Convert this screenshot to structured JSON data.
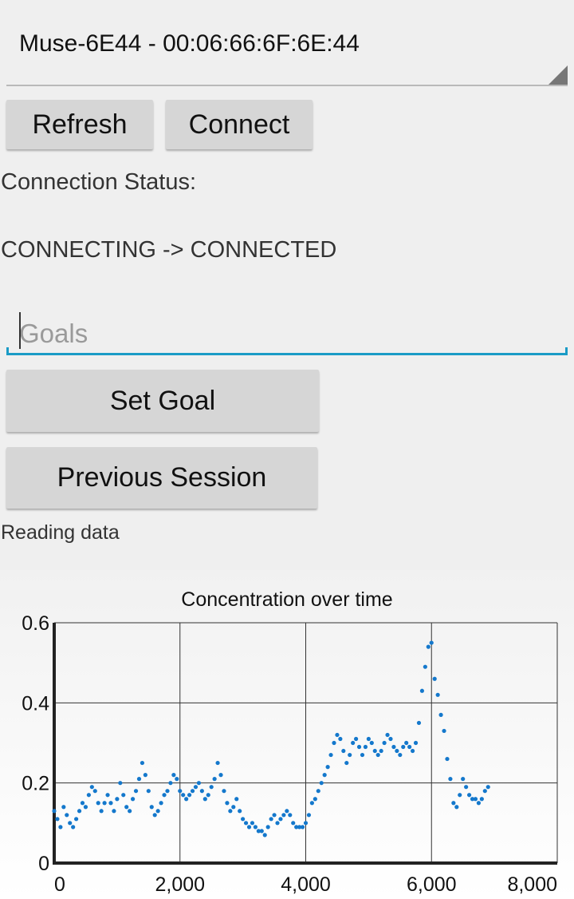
{
  "device_selector": {
    "selected": "Muse-6E44 - 00:06:66:6F:6E:44"
  },
  "buttons": {
    "refresh": "Refresh",
    "connect": "Connect",
    "set_goal": "Set Goal",
    "previous_session": "Previous Session"
  },
  "connection": {
    "label": "Connection Status:",
    "value": "CONNECTING -> CONNECTED"
  },
  "goals_input": {
    "placeholder": "Goals",
    "value": ""
  },
  "reading_status": "Reading data",
  "colors": {
    "accent": "#1a9bc6",
    "series": "#1478cc",
    "button": "#d6d6d6"
  },
  "chart_data": {
    "type": "scatter",
    "title": "Concentration over time",
    "xlabel": "",
    "ylabel": "",
    "xlim": [
      0,
      8000
    ],
    "ylim": [
      0,
      0.6
    ],
    "x_ticks": [
      0,
      2000,
      4000,
      6000,
      8000
    ],
    "x_tick_labels": [
      "0",
      "2,000",
      "4,000",
      "6,000",
      "8,000"
    ],
    "y_ticks": [
      0,
      0.2,
      0.4,
      0.6
    ],
    "y_tick_labels": [
      "0",
      "0.2",
      "0.4",
      "0.6"
    ],
    "grid": true,
    "series": [
      {
        "color": "#1478cc",
        "points": [
          [
            0,
            0.13
          ],
          [
            50,
            0.11
          ],
          [
            100,
            0.09
          ],
          [
            150,
            0.14
          ],
          [
            200,
            0.12
          ],
          [
            250,
            0.1
          ],
          [
            300,
            0.09
          ],
          [
            350,
            0.11
          ],
          [
            400,
            0.13
          ],
          [
            450,
            0.15
          ],
          [
            500,
            0.14
          ],
          [
            550,
            0.17
          ],
          [
            600,
            0.19
          ],
          [
            650,
            0.18
          ],
          [
            700,
            0.15
          ],
          [
            750,
            0.13
          ],
          [
            800,
            0.15
          ],
          [
            850,
            0.17
          ],
          [
            900,
            0.15
          ],
          [
            950,
            0.13
          ],
          [
            1000,
            0.16
          ],
          [
            1050,
            0.2
          ],
          [
            1100,
            0.17
          ],
          [
            1150,
            0.14
          ],
          [
            1200,
            0.13
          ],
          [
            1250,
            0.16
          ],
          [
            1300,
            0.18
          ],
          [
            1350,
            0.21
          ],
          [
            1400,
            0.25
          ],
          [
            1450,
            0.22
          ],
          [
            1500,
            0.18
          ],
          [
            1550,
            0.14
          ],
          [
            1600,
            0.12
          ],
          [
            1650,
            0.13
          ],
          [
            1700,
            0.15
          ],
          [
            1750,
            0.17
          ],
          [
            1800,
            0.18
          ],
          [
            1850,
            0.2
          ],
          [
            1900,
            0.22
          ],
          [
            1950,
            0.21
          ],
          [
            2000,
            0.18
          ],
          [
            2050,
            0.17
          ],
          [
            2100,
            0.16
          ],
          [
            2150,
            0.17
          ],
          [
            2200,
            0.18
          ],
          [
            2250,
            0.19
          ],
          [
            2300,
            0.2
          ],
          [
            2350,
            0.18
          ],
          [
            2400,
            0.16
          ],
          [
            2450,
            0.17
          ],
          [
            2500,
            0.19
          ],
          [
            2550,
            0.21
          ],
          [
            2600,
            0.25
          ],
          [
            2650,
            0.22
          ],
          [
            2700,
            0.18
          ],
          [
            2750,
            0.15
          ],
          [
            2800,
            0.13
          ],
          [
            2850,
            0.14
          ],
          [
            2900,
            0.16
          ],
          [
            2950,
            0.13
          ],
          [
            3000,
            0.11
          ],
          [
            3050,
            0.1
          ],
          [
            3100,
            0.09
          ],
          [
            3150,
            0.1
          ],
          [
            3200,
            0.09
          ],
          [
            3250,
            0.08
          ],
          [
            3300,
            0.08
          ],
          [
            3350,
            0.07
          ],
          [
            3400,
            0.09
          ],
          [
            3450,
            0.11
          ],
          [
            3500,
            0.12
          ],
          [
            3550,
            0.1
          ],
          [
            3600,
            0.11
          ],
          [
            3650,
            0.12
          ],
          [
            3700,
            0.13
          ],
          [
            3750,
            0.12
          ],
          [
            3800,
            0.1
          ],
          [
            3850,
            0.09
          ],
          [
            3900,
            0.09
          ],
          [
            3950,
            0.09
          ],
          [
            4000,
            0.1
          ],
          [
            4050,
            0.12
          ],
          [
            4100,
            0.15
          ],
          [
            4150,
            0.16
          ],
          [
            4200,
            0.18
          ],
          [
            4250,
            0.2
          ],
          [
            4300,
            0.22
          ],
          [
            4350,
            0.24
          ],
          [
            4400,
            0.27
          ],
          [
            4450,
            0.3
          ],
          [
            4500,
            0.32
          ],
          [
            4550,
            0.31
          ],
          [
            4600,
            0.28
          ],
          [
            4650,
            0.25
          ],
          [
            4700,
            0.27
          ],
          [
            4750,
            0.3
          ],
          [
            4800,
            0.31
          ],
          [
            4850,
            0.29
          ],
          [
            4900,
            0.27
          ],
          [
            4950,
            0.29
          ],
          [
            5000,
            0.31
          ],
          [
            5050,
            0.3
          ],
          [
            5100,
            0.28
          ],
          [
            5150,
            0.27
          ],
          [
            5200,
            0.28
          ],
          [
            5250,
            0.3
          ],
          [
            5300,
            0.32
          ],
          [
            5350,
            0.31
          ],
          [
            5400,
            0.29
          ],
          [
            5450,
            0.28
          ],
          [
            5500,
            0.27
          ],
          [
            5550,
            0.29
          ],
          [
            5600,
            0.3
          ],
          [
            5650,
            0.29
          ],
          [
            5700,
            0.28
          ],
          [
            5750,
            0.3
          ],
          [
            5800,
            0.35
          ],
          [
            5850,
            0.43
          ],
          [
            5900,
            0.49
          ],
          [
            5950,
            0.54
          ],
          [
            6000,
            0.55
          ],
          [
            6050,
            0.46
          ],
          [
            6100,
            0.42
          ],
          [
            6150,
            0.37
          ],
          [
            6200,
            0.33
          ],
          [
            6250,
            0.26
          ],
          [
            6300,
            0.21
          ],
          [
            6350,
            0.15
          ],
          [
            6400,
            0.14
          ],
          [
            6450,
            0.17
          ],
          [
            6500,
            0.21
          ],
          [
            6550,
            0.19
          ],
          [
            6600,
            0.17
          ],
          [
            6650,
            0.16
          ],
          [
            6700,
            0.16
          ],
          [
            6750,
            0.15
          ],
          [
            6800,
            0.16
          ],
          [
            6850,
            0.18
          ],
          [
            6900,
            0.19
          ]
        ]
      }
    ]
  }
}
